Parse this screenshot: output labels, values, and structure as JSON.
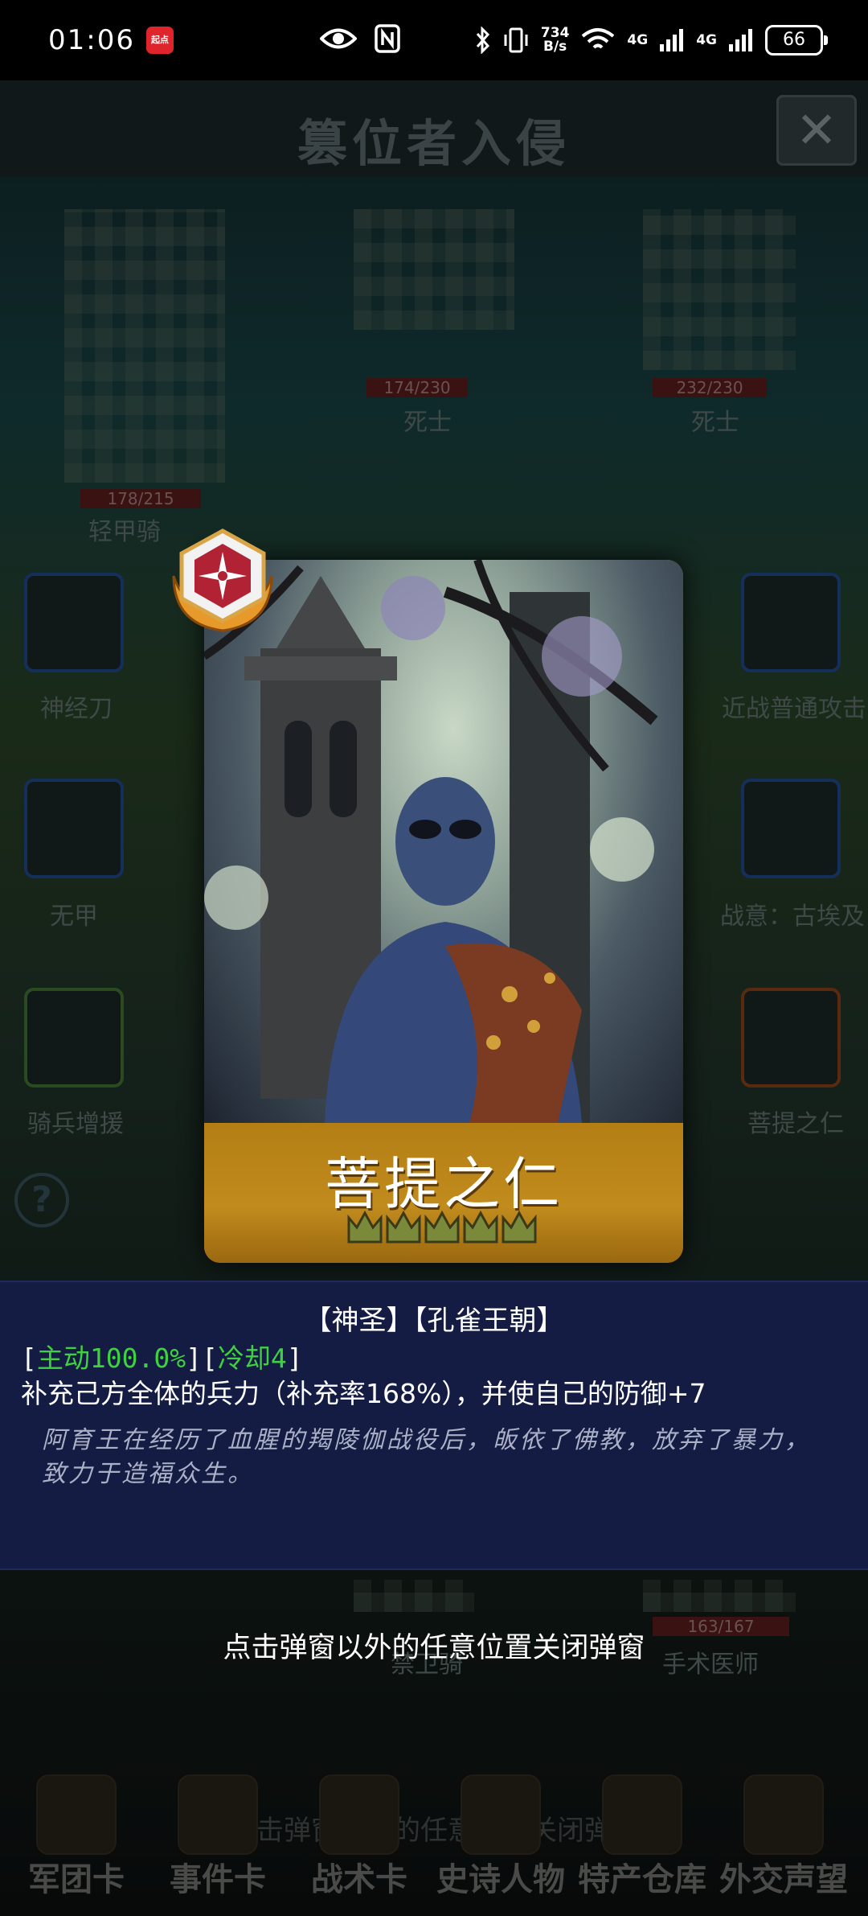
{
  "status_bar": {
    "time": "01:06",
    "app_badge": "起点",
    "net_speed_top": "734",
    "net_speed_bottom": "B/s",
    "net1": "4G",
    "net2": "4G",
    "battery": "66"
  },
  "background": {
    "title": "篡位者入侵",
    "close_glyph": "✕",
    "units": [
      {
        "hp": "178/215",
        "name": "轻甲骑"
      },
      {
        "hp": "174/230",
        "name": "死士"
      },
      {
        "hp": "232/230",
        "name": "死士"
      },
      {
        "hp": "163/167",
        "name": "手术医师"
      },
      {
        "hp": "",
        "name": "禁卫骑"
      }
    ],
    "left_slots": [
      "神经刀",
      "无甲",
      "骑兵增援"
    ],
    "right_slots": [
      "近战普通攻击",
      "战意：古埃及",
      "菩提之仁"
    ],
    "hint": "点击弹窗以外的任意位置关闭弹窗"
  },
  "tabs": [
    {
      "label": "军团卡"
    },
    {
      "label": "事件卡"
    },
    {
      "label": "战术卡"
    },
    {
      "label": "史诗人物"
    },
    {
      "label": "特产仓库"
    },
    {
      "label": "外交声望"
    }
  ],
  "card": {
    "name": "菩提之仁",
    "crowns": 5,
    "badge_icon": "compass-laurel-badge"
  },
  "description": {
    "tags": "【神圣】【孔雀王朝】",
    "bracket_open": "[",
    "active": "主动100.0%",
    "bracket_mid": "][",
    "cooldown": "冷却4",
    "bracket_close": "]",
    "effect": "补充己方全体的兵力（补充率168%），并使自己的防御+7",
    "flavor": "阿育王在经历了血腥的羯陵伽战役后，皈依了佛教，放弃了暴力，致力于造福众生。"
  },
  "close_hint": "点击弹窗以外的任意位置关闭弹窗",
  "colors": {
    "desc_bg": "#141c44",
    "card_gold": "#c08a1e",
    "active_green": "#3fd13f"
  }
}
